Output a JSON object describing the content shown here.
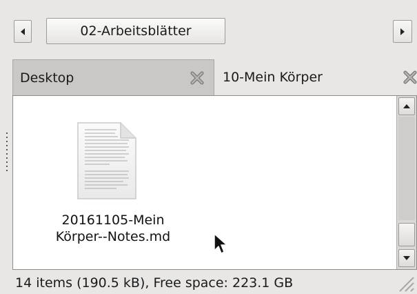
{
  "pathbar": {
    "current": "02-Arbeitsblätter",
    "back_icon": "triangle-left-icon",
    "forward_icon": "triangle-right-icon"
  },
  "tabs": [
    {
      "label": "Desktop",
      "active": true,
      "close_icon": "close-x-icon"
    },
    {
      "label": "10-Mein Körper",
      "active": false,
      "close_icon": "close-x-icon"
    }
  ],
  "files": [
    {
      "line1": "20161105-Mein",
      "line2": "Körper--Notes.md",
      "icon": "text-document-icon"
    }
  ],
  "statusbar": {
    "text": "14 items (190.5 kB), Free space: 223.1 GB"
  },
  "colors": {
    "window_bg": "#e8e7e6",
    "content_bg": "#ffffff",
    "active_tab_bg": "#c9c8c6"
  }
}
